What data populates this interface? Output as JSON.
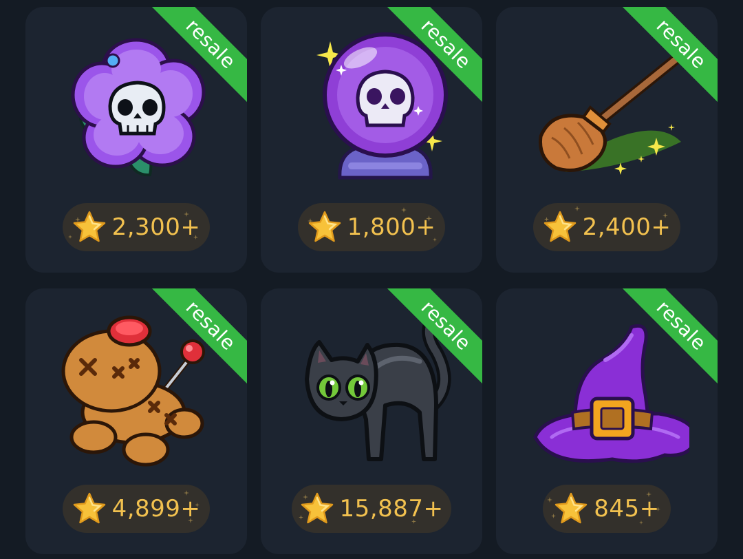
{
  "badge_label": "resale",
  "colors": {
    "background": "#141b24",
    "card": "#1c2430",
    "ribbon": "#36b844",
    "price_pill": "#33302b",
    "price_text": "#f2c14f"
  },
  "items": [
    {
      "icon": "skull-flower-icon",
      "price": "2,300+"
    },
    {
      "icon": "crystal-ball-icon",
      "price": "1,800+"
    },
    {
      "icon": "witch-broom-icon",
      "price": "2,400+"
    },
    {
      "icon": "voodoo-doll-icon",
      "price": "4,899+"
    },
    {
      "icon": "black-cat-icon",
      "price": "15,887+"
    },
    {
      "icon": "witch-hat-icon",
      "price": "845+"
    }
  ]
}
